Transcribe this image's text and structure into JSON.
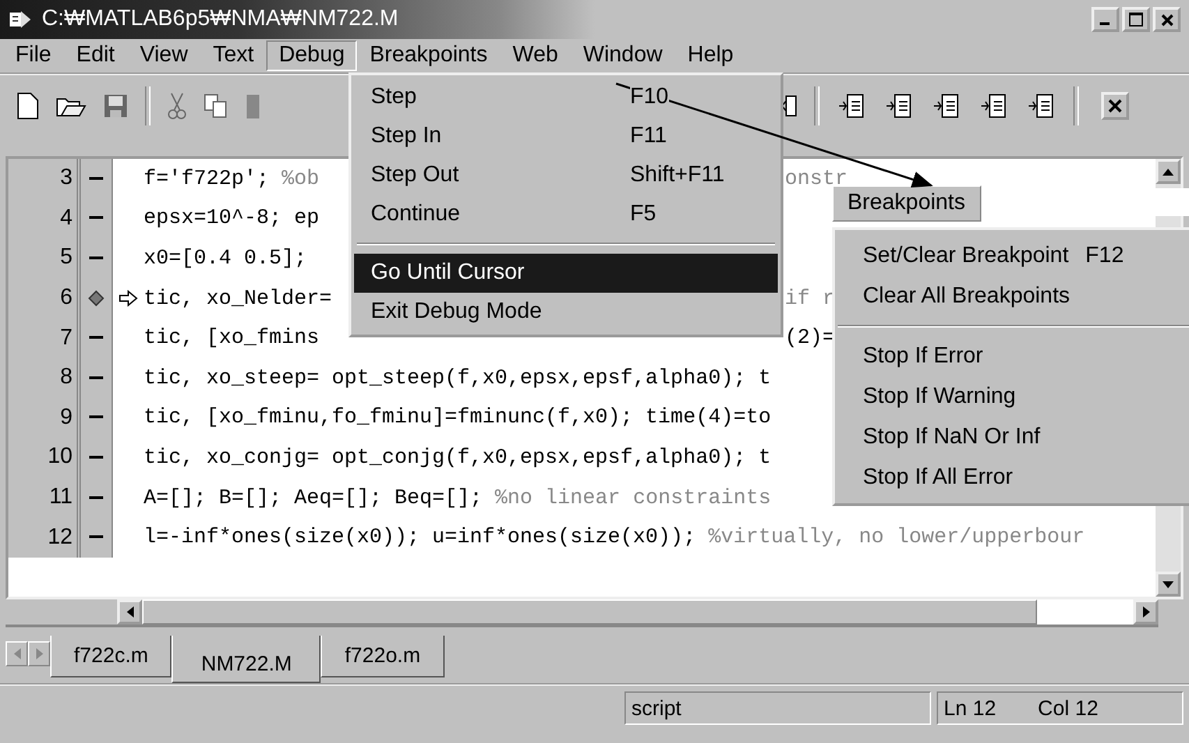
{
  "window": {
    "title": "C:₩MATLAB6p5₩NMA₩NM722.M"
  },
  "menu_bar": [
    {
      "label": "File",
      "selected": false
    },
    {
      "label": "Edit",
      "selected": false
    },
    {
      "label": "View",
      "selected": false
    },
    {
      "label": "Text",
      "selected": false
    },
    {
      "label": "Debug",
      "selected": true
    },
    {
      "label": "Breakpoints",
      "selected": false
    },
    {
      "label": "Web",
      "selected": false
    },
    {
      "label": "Window",
      "selected": false
    },
    {
      "label": "Help",
      "selected": false
    }
  ],
  "debug_menu": {
    "items": [
      {
        "kind": "item",
        "label": "Step",
        "shortcut": "F10",
        "highlighted": false
      },
      {
        "kind": "item",
        "label": "Step In",
        "shortcut": "F11",
        "highlighted": false
      },
      {
        "kind": "item",
        "label": "Step Out",
        "shortcut": "Shift+F11",
        "highlighted": false
      },
      {
        "kind": "item",
        "label": "Continue",
        "shortcut": "F5",
        "highlighted": false
      },
      {
        "kind": "separator"
      },
      {
        "kind": "item",
        "label": "Go Until Cursor",
        "highlighted": true
      },
      {
        "kind": "item",
        "label": "Exit Debug Mode",
        "highlighted": false
      }
    ]
  },
  "breakpoints_menu": {
    "title": "Breakpoints",
    "items": [
      {
        "kind": "item",
        "label": "Set/Clear Breakpoint",
        "shortcut": "F12"
      },
      {
        "kind": "item",
        "label": "Clear All Breakpoints"
      },
      {
        "kind": "separator"
      },
      {
        "kind": "item",
        "label": "Stop If Error"
      },
      {
        "kind": "item",
        "label": "Stop If Warning"
      },
      {
        "kind": "item",
        "label": "Stop If NaN Or Inf"
      },
      {
        "kind": "item",
        "label": "Stop If All Error"
      }
    ]
  },
  "editor": {
    "lines": [
      {
        "number": "3",
        "breakpoint": false,
        "current": false,
        "left": [
          {
            "text": "f='f722p'; ",
            "kind": "code"
          },
          {
            "text": "%ob",
            "kind": "comment"
          }
        ],
        "right": [
          {
            "text": "onstr",
            "kind": "comment"
          }
        ]
      },
      {
        "number": "4",
        "breakpoint": false,
        "current": false,
        "left": [
          {
            "text": "epsx=10^-8; ep",
            "kind": "code"
          }
        ]
      },
      {
        "number": "5",
        "breakpoint": false,
        "current": false,
        "left": [
          {
            "text": "x0=[0.4 0.5];",
            "kind": "code"
          }
        ]
      },
      {
        "number": "6",
        "breakpoint": true,
        "current": true,
        "left": [
          {
            "text": "tic, xo_Nelder=",
            "kind": "code"
          }
        ],
        "right": [
          {
            "text": "if r",
            "kind": "comment"
          }
        ]
      },
      {
        "number": "7",
        "breakpoint": false,
        "current": false,
        "left": [
          {
            "text": "tic, [xo_fmins",
            "kind": "code"
          }
        ],
        "right": [
          {
            "text": "(2)=",
            "kind": "code"
          }
        ]
      },
      {
        "number": "8",
        "breakpoint": false,
        "current": false,
        "left": [
          {
            "text": "tic, xo_steep= opt_steep(f,x0,epsx,epsf,alpha0); t",
            "kind": "code"
          }
        ]
      },
      {
        "number": "9",
        "breakpoint": false,
        "current": false,
        "left": [
          {
            "text": "tic, [xo_fminu,fo_fminu]=fminunc(f,x0); time(4)=to",
            "kind": "code"
          }
        ]
      },
      {
        "number": "10",
        "breakpoint": false,
        "current": false,
        "left": [
          {
            "text": "tic, xo_conjg= opt_conjg(f,x0,epsx,epsf,alpha0); t",
            "kind": "code"
          }
        ]
      },
      {
        "number": "11",
        "breakpoint": false,
        "current": false,
        "left": [
          {
            "text": "A=[]; B=[]; Aeq=[]; Beq=[]; ",
            "kind": "code"
          },
          {
            "text": "%no linear constraints",
            "kind": "comment"
          }
        ]
      },
      {
        "number": "12",
        "breakpoint": false,
        "current": false,
        "left": [
          {
            "text": "l=-inf*ones(size(x0)); u=inf*ones(size(x0)); ",
            "kind": "code"
          },
          {
            "text": "%virtually, no lower/upperbour",
            "kind": "comment"
          }
        ]
      }
    ]
  },
  "tabs": [
    {
      "label": "f722c.m",
      "selected": false
    },
    {
      "label": "NM722.M",
      "selected": true
    },
    {
      "label": "f722o.m",
      "selected": false
    }
  ],
  "status_bar": {
    "mode": "script",
    "line": "Ln 12",
    "column": "Col 12"
  }
}
